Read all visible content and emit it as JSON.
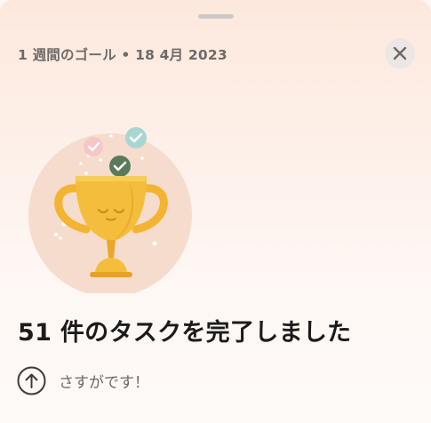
{
  "header": {
    "title": "1 週間のゴール • 18 4月 2023"
  },
  "illustration": {
    "name": "trophy-with-checkmarks",
    "colors": {
      "circle": "#f6dccd",
      "trophy": "#f2b431",
      "check_dark": "#5a7a5c",
      "check_teal": "#a9d6d2",
      "check_pink": "#f6c3c8"
    }
  },
  "main": {
    "headline": "51 件のタスクを完了しました",
    "encouragement": "さすがです！",
    "encouragement_icon": "arrow-up-circle-icon"
  },
  "colors": {
    "background_top": "#fde8dd",
    "background_bottom": "#fefaf8",
    "text_primary": "#1c1b1b",
    "text_secondary": "#6e6a68",
    "close_button_bg": "#ece7e4"
  }
}
